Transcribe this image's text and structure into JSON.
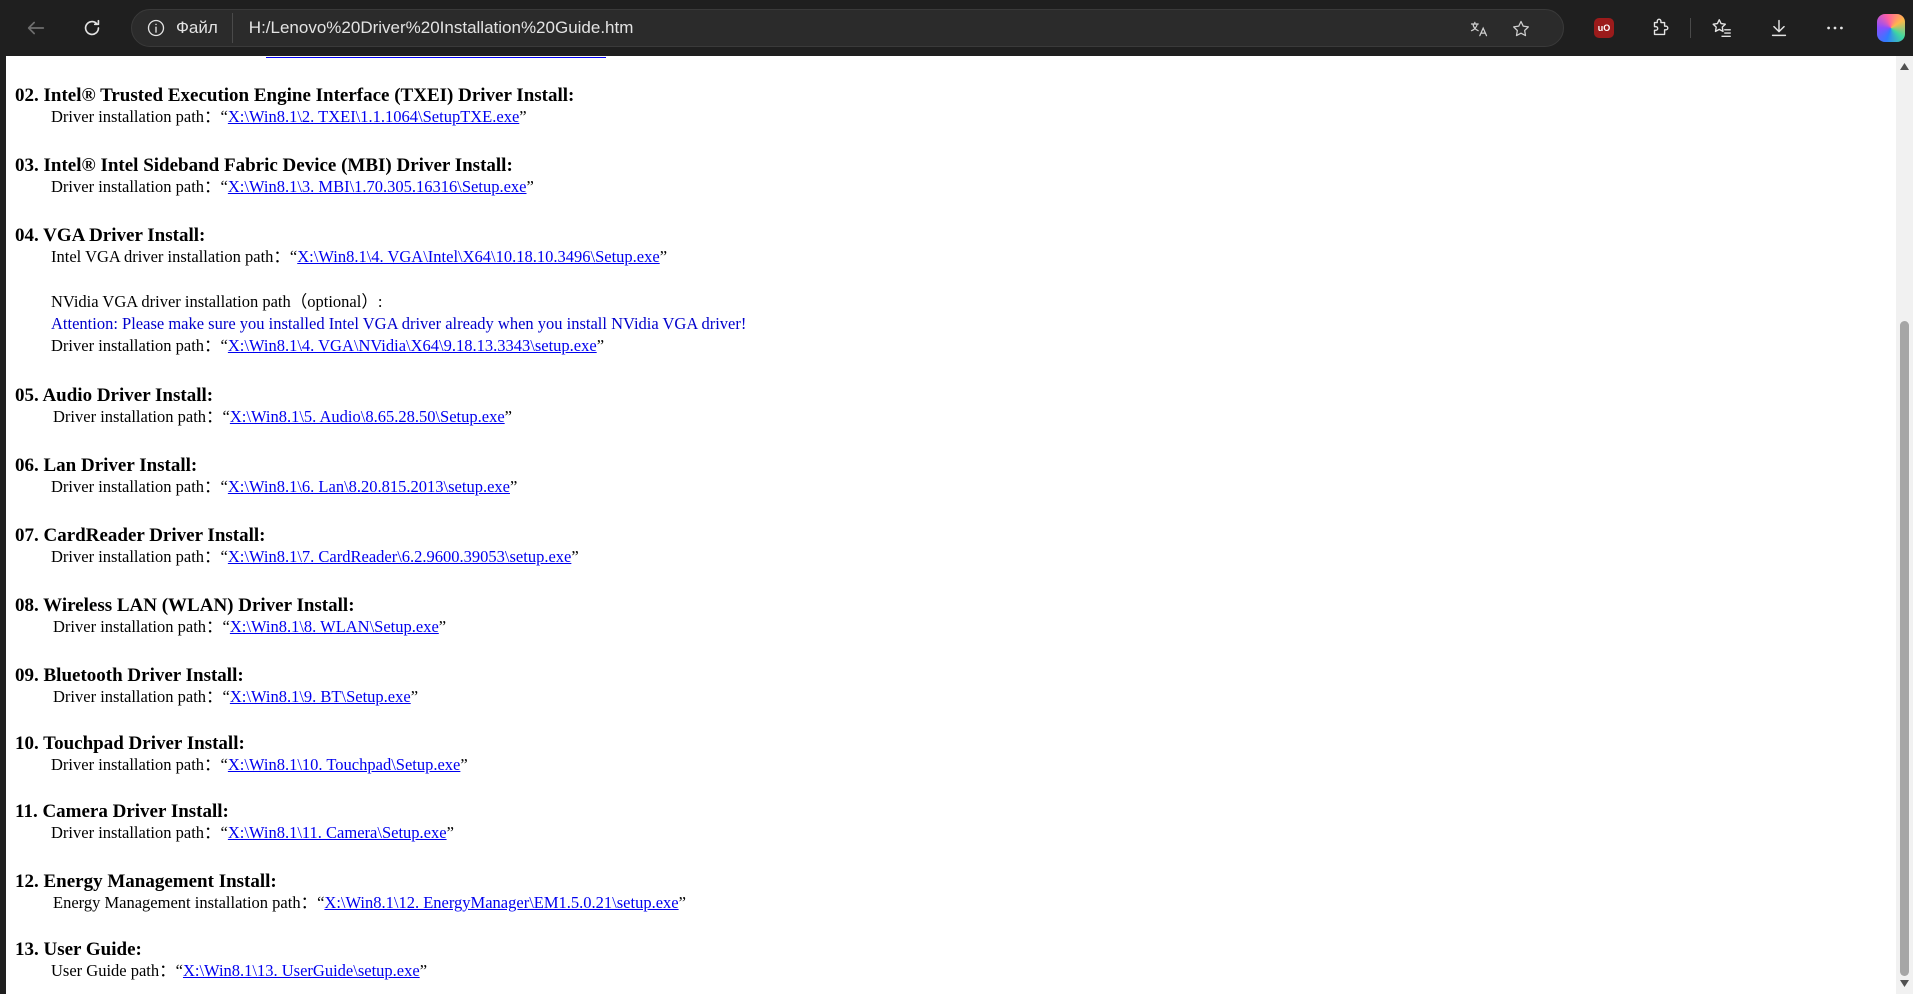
{
  "browser": {
    "site_label": "Файл",
    "url": "H:/Lenovo%20Driver%20Installation%20Guide.htm",
    "ublock_badge": "uO"
  },
  "sections": [
    {
      "title": "02. Intel® Trusted Execution Engine Interface (TXEI) Driver Install:",
      "lines": [
        {
          "label": "Driver installation path：",
          "open": "“",
          "path": "X:\\Win8.1\\2. TXEI\\1.1.1064\\SetupTXE.exe",
          "close": "”"
        }
      ]
    },
    {
      "title": "03.  Intel® Intel Sideband Fabric Device (MBI) Driver Install:",
      "lines": [
        {
          "label": "Driver installation path：",
          "open": "“",
          "path": "X:\\Win8.1\\3. MBI\\1.70.305.16316\\Setup.exe",
          "close": "”"
        }
      ]
    },
    {
      "title": "04. VGA Driver Install:",
      "lines": [
        {
          "label": "Intel VGA driver installation path：",
          "open": "“",
          "path": "X:\\Win8.1\\4. VGA\\Intel\\X64\\10.18.10.3496\\Setup.exe",
          "close": "”"
        }
      ],
      "optional_label": "NVidia VGA driver installation path（optional）:",
      "attention": "Attention: Please make sure you installed Intel VGA driver already when you install NVidia VGA driver!",
      "nvidia_line": {
        "label": "Driver installation path：",
        "open": "“",
        "path": "X:\\Win8.1\\4. VGA\\NVidia\\X64\\9.18.13.3343\\setup.exe",
        "close": "”"
      }
    },
    {
      "title": "05. Audio Driver Install:",
      "lines": [
        {
          "label": "Driver installation path：",
          "open": "“",
          "path": "X:\\Win8.1\\5. Audio\\8.65.28.50\\Setup.exe",
          "close": "”"
        }
      ]
    },
    {
      "title": "06. Lan Driver Install:",
      "lines": [
        {
          "label": "Driver installation path：",
          "open": "“",
          "path": "X:\\Win8.1\\6. Lan\\8.20.815.2013\\setup.exe",
          "close": "”"
        }
      ]
    },
    {
      "title": "07. CardReader Driver Install:",
      "lines": [
        {
          "label": "Driver installation path：",
          "open": "“",
          "path": "X:\\Win8.1\\7. CardReader\\6.2.9600.39053\\setup.exe",
          "close": "”"
        }
      ]
    },
    {
      "title": "08. Wireless LAN (WLAN) Driver Install:",
      "lines": [
        {
          "label": "Driver installation path：",
          "open": "“",
          "path": "X:\\Win8.1\\8. WLAN\\Setup.exe",
          "close": "”"
        }
      ]
    },
    {
      "title": "09. Bluetooth Driver Install:",
      "lines": [
        {
          "label": "Driver installation path：",
          "open": "“",
          "path": "X:\\Win8.1\\9. BT\\Setup.exe",
          "close": "”"
        }
      ]
    },
    {
      "title": "10. Touchpad Driver Install:",
      "lines": [
        {
          "label": "Driver installation path：",
          "open": "“",
          "path": "X:\\Win8.1\\10. Touchpad\\Setup.exe",
          "close": "”"
        }
      ]
    },
    {
      "title": "11. Camera Driver Install:",
      "lines": [
        {
          "label": "Driver installation path：",
          "open": "“",
          "path": "X:\\Win8.1\\11. Camera\\Setup.exe",
          "close": "”"
        }
      ]
    },
    {
      "title": "12.  Energy Management Install:",
      "lines": [
        {
          "label": "Energy Management installation path：",
          "open": "“",
          "path": "X:\\Win8.1\\12. EnergyManager\\EM1.5.0.21\\setup.exe",
          "close": "”"
        }
      ]
    },
    {
      "title": "13.  User Guide:",
      "lines": [
        {
          "label": "User Guide path：",
          "open": "“",
          "path": "X:\\Win8.1\\13. UserGuide\\setup.exe",
          "close": "”"
        }
      ]
    }
  ]
}
